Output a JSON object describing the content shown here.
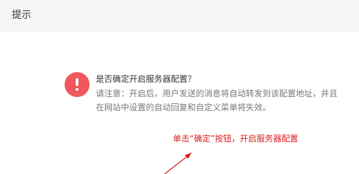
{
  "dialog": {
    "title": "提示",
    "question": "是否确定开启服务器配置？",
    "notice": "请注意：开启后，用户发送的消息将自动转发到该配置地址，并且在网站中设置的自动回复和自定义菜单将失效。",
    "icon": "warning-icon",
    "icon_color": "#f0585b"
  },
  "annotation": {
    "text": "单击“确定”按钮，开启服务器配置",
    "color": "#d9201f"
  }
}
